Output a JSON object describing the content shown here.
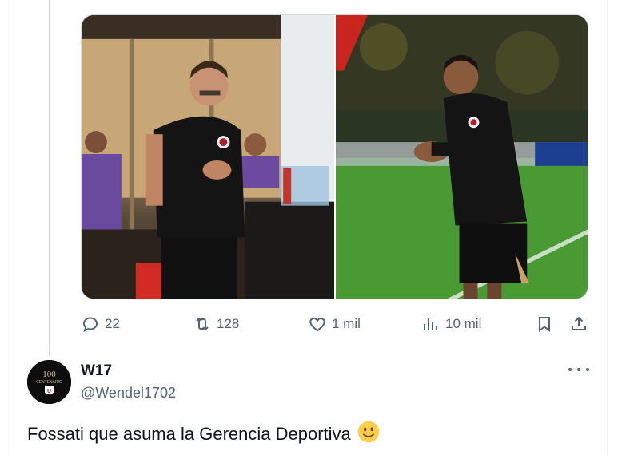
{
  "tweet": {
    "media": [
      {
        "alt": "",
        "icon": "photo-coach-locker-room"
      },
      {
        "alt": "",
        "icon": "photo-coach-stadium"
      }
    ],
    "actions": {
      "reply_count": "22",
      "retweet_count": "128",
      "like_count": "1 mil",
      "views_count": "10 mil"
    }
  },
  "reply": {
    "display_name": "W17",
    "handle": "@Wendel1702",
    "text": "Fossati que asuma la Gerencia Deportiva",
    "avatar_text": "100 CENTENARIO"
  },
  "colors": {
    "text": "#0f1419",
    "muted": "#536471",
    "border": "#cfd9de",
    "thread_line": "#cfd9de",
    "emoji": "#ffcc4d"
  }
}
